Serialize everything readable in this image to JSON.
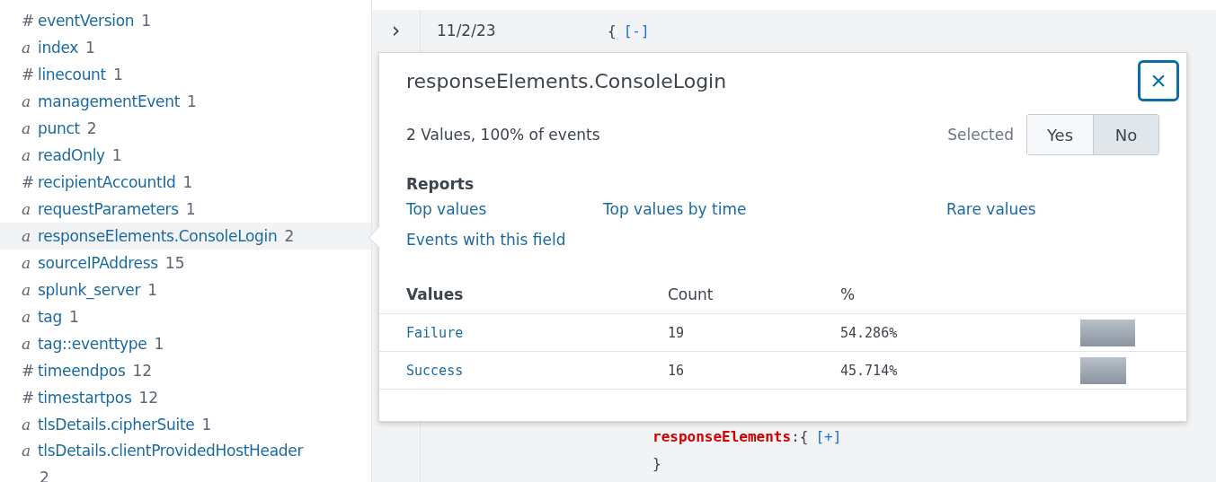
{
  "fields": [
    {
      "kind": "number",
      "icon": "#",
      "name": "eventVersion",
      "count": "1",
      "selected": false
    },
    {
      "kind": "string",
      "icon": "a",
      "name": "index",
      "count": "1",
      "selected": false
    },
    {
      "kind": "number",
      "icon": "#",
      "name": "linecount",
      "count": "1",
      "selected": false
    },
    {
      "kind": "string",
      "icon": "a",
      "name": "managementEvent",
      "count": "1",
      "selected": false
    },
    {
      "kind": "string",
      "icon": "a",
      "name": "punct",
      "count": "2",
      "selected": false
    },
    {
      "kind": "string",
      "icon": "a",
      "name": "readOnly",
      "count": "1",
      "selected": false
    },
    {
      "kind": "number",
      "icon": "#",
      "name": "recipientAccountId",
      "count": "1",
      "selected": false
    },
    {
      "kind": "string",
      "icon": "a",
      "name": "requestParameters",
      "count": "1",
      "selected": false
    },
    {
      "kind": "string",
      "icon": "a",
      "name": "responseElements.ConsoleLogin",
      "count": "2",
      "selected": true
    },
    {
      "kind": "string",
      "icon": "a",
      "name": "sourceIPAddress",
      "count": "15",
      "selected": false
    },
    {
      "kind": "string",
      "icon": "a",
      "name": "splunk_server",
      "count": "1",
      "selected": false
    },
    {
      "kind": "string",
      "icon": "a",
      "name": "tag",
      "count": "1",
      "selected": false
    },
    {
      "kind": "string",
      "icon": "a",
      "name": "tag::eventtype",
      "count": "1",
      "selected": false
    },
    {
      "kind": "number",
      "icon": "#",
      "name": "timeendpos",
      "count": "12",
      "selected": false
    },
    {
      "kind": "number",
      "icon": "#",
      "name": "timestartpos",
      "count": "12",
      "selected": false
    },
    {
      "kind": "string",
      "icon": "a",
      "name": "tlsDetails.cipherSuite",
      "count": "1",
      "selected": false
    },
    {
      "kind": "string",
      "icon": "a",
      "name": "tlsDetails.clientProvidedHostHeader",
      "count": "2",
      "selected": false
    }
  ],
  "event": {
    "expand_icon": "›",
    "time": "11/2/23",
    "open_brace": "{",
    "collapse_link": "[-]",
    "lines": [
      {
        "key": "responseElements",
        "colon": ":",
        "brace": "{",
        "link": "[+]"
      },
      {
        "close": "}"
      }
    ]
  },
  "popup": {
    "title": "responseElements.ConsoleLogin",
    "close": "×",
    "summary": "2 Values, 100% of events",
    "selected_label": "Selected",
    "selected_options": [
      {
        "label": "Yes",
        "selected": false
      },
      {
        "label": "No",
        "selected": true
      }
    ],
    "reports_heading": "Reports",
    "reports": [
      "Top values",
      "Top values by time",
      "Rare values",
      "Events with this field"
    ],
    "columns": [
      "Values",
      "Count",
      "%"
    ],
    "rows": [
      {
        "value": "Failure",
        "count": "19",
        "percent": "54.286%",
        "level": 0.54286
      },
      {
        "value": "Success",
        "count": "16",
        "percent": "45.714%",
        "level": 0.45714
      }
    ]
  }
}
